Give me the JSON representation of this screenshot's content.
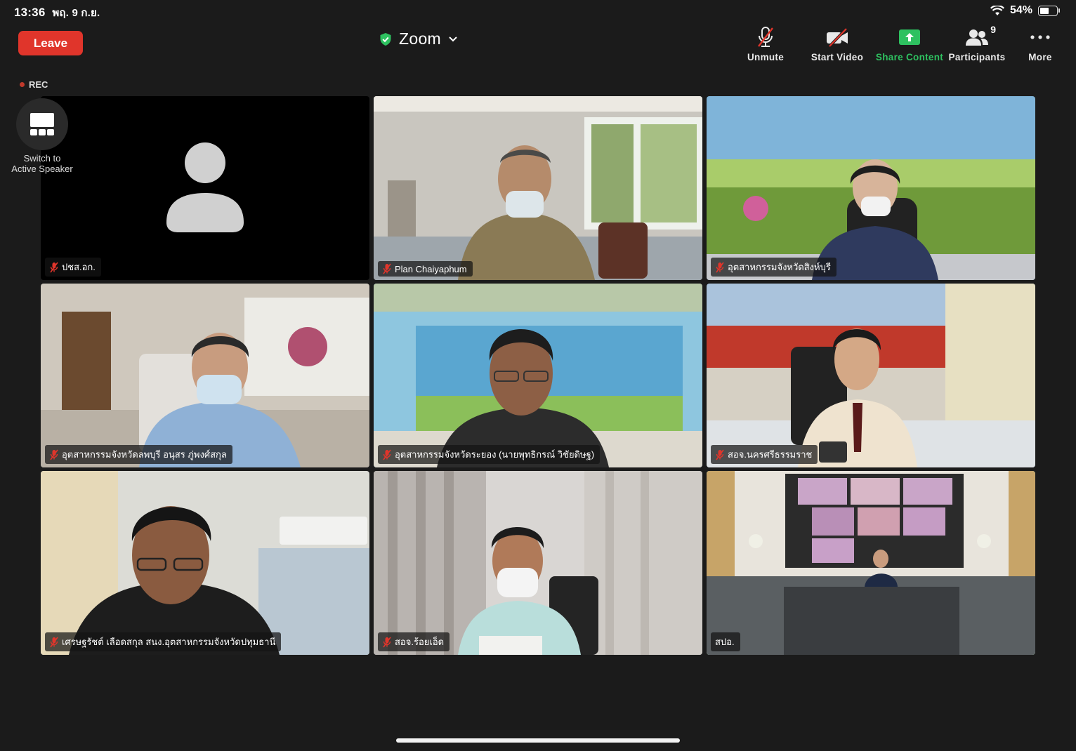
{
  "status_bar": {
    "time": "13:36",
    "date": "พฤ. 9 ก.ย.",
    "battery": "54%",
    "battery_level": 0.54
  },
  "toolbar": {
    "leave_label": "Leave",
    "meeting_title": "Zoom",
    "unmute_label": "Unmute",
    "start_video_label": "Start Video",
    "share_label": "Share Content",
    "participants_label": "Participants",
    "participants_count": "9",
    "more_label": "More"
  },
  "rec_label": "REC",
  "switch_view": {
    "line1": "Switch to",
    "line2": "Active Speaker"
  },
  "colors": {
    "leave": "#e0352b",
    "share": "#2ec160",
    "active_speaker_border": "#35c463",
    "mute": "#e0352b"
  },
  "participants": [
    {
      "name": "ปชส.อก.",
      "muted": true,
      "video": false
    },
    {
      "name": "Plan Chaiyaphum",
      "muted": true,
      "video": true
    },
    {
      "name": "อุตสาหกรรมจังหวัดสิงห์บุรี",
      "muted": true,
      "video": true
    },
    {
      "name": "อุตสาหกรรมจังหวัดลพบุรี อนุสร ภู่พงศ์สกุล",
      "muted": true,
      "video": true
    },
    {
      "name": "อุตสาหกรรมจังหวัดระยอง (นายพุทธิกรณ์ วิชัยดิษฐ)",
      "muted": true,
      "video": true
    },
    {
      "name": "สอจ.นครศรีธรรมราช",
      "muted": true,
      "video": true
    },
    {
      "name": "เศรษฐรัชต์ เลือดสกุล สนง.อุตสาหกรรมจังหวัดปทุมธานี",
      "muted": true,
      "video": true
    },
    {
      "name": "สอจ.ร้อยเอ็ด",
      "muted": true,
      "video": true
    },
    {
      "name": "สปอ.",
      "muted": false,
      "video": true,
      "active": true
    }
  ]
}
